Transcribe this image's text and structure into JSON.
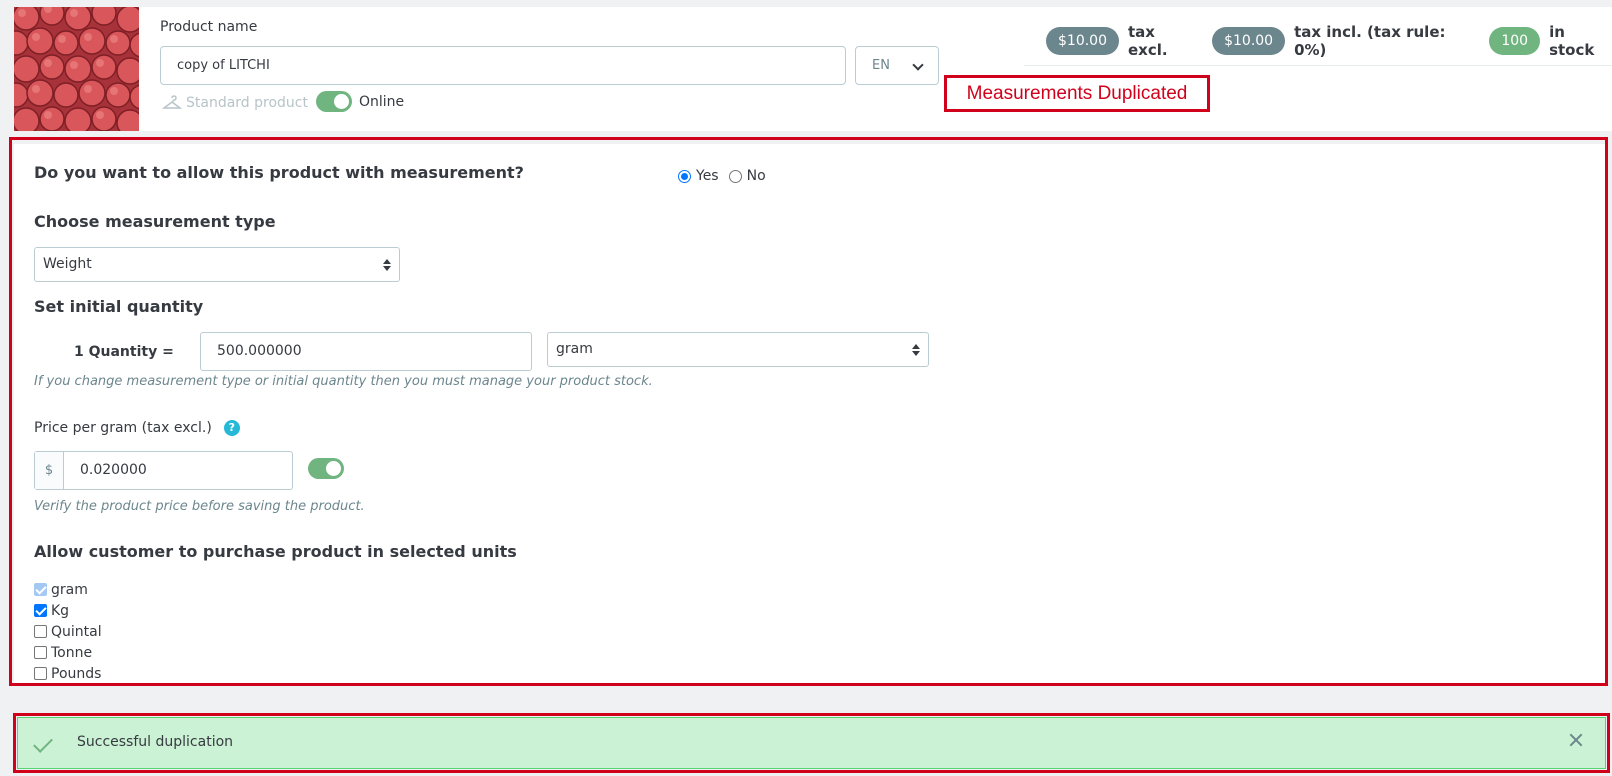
{
  "header": {
    "product_name_label": "Product name",
    "product_name_value": "copy of LITCHI",
    "language": "EN",
    "product_type": "Standard product",
    "online_label": "Online",
    "online_enabled": true,
    "price_tax_excl": "$10.00",
    "tax_excl_label": "tax excl.",
    "price_tax_incl": "$10.00",
    "tax_incl_label": "tax incl. (tax rule: 0%)",
    "stock_count": "100",
    "stock_label": "in stock",
    "annotation": "Measurements Duplicated"
  },
  "measurement": {
    "allow_question": "Do you want to allow this product with measurement?",
    "yes_label": "Yes",
    "no_label": "No",
    "allow_selected": "Yes",
    "type_heading": "Choose measurement type",
    "type_value": "Weight",
    "qty_heading": "Set initial quantity",
    "qty_label": "1 Quantity =",
    "qty_value": "500.000000",
    "unit_value": "gram",
    "qty_hint": "If you change measurement type or initial quantity then you must manage your product stock.",
    "price_label": "Price per gram (tax excl.)",
    "price_help_icon": "question-circle-icon",
    "currency": "$",
    "price_value": "0.020000",
    "price_toggle_enabled": true,
    "price_hint": "Verify the product price before saving the product.",
    "units_heading": "Allow customer to purchase product in selected units",
    "units": [
      {
        "label": "gram",
        "checked": true,
        "disabled": true
      },
      {
        "label": "Kg",
        "checked": true,
        "disabled": false
      },
      {
        "label": "Quintal",
        "checked": false,
        "disabled": false
      },
      {
        "label": "Tonne",
        "checked": false,
        "disabled": false
      },
      {
        "label": "Pounds",
        "checked": false,
        "disabled": false
      }
    ]
  },
  "alert": {
    "message": "Successful duplication",
    "icon": "check-icon",
    "close_icon": "close-icon"
  },
  "colors": {
    "annotation_red": "#d0021b",
    "success_bg": "#cbf2d4",
    "toggle_green": "#70b580",
    "pill_grey": "#6c868e"
  }
}
